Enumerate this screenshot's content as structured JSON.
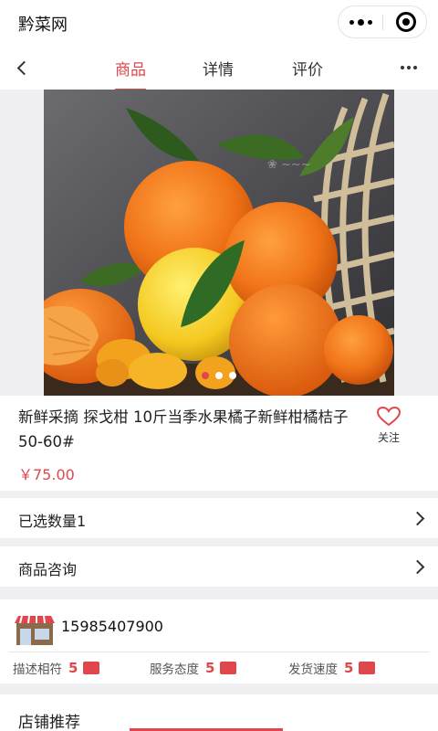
{
  "app": {
    "title": "黔菜网"
  },
  "capsule": {
    "more_icon": "more-dots-icon",
    "close_icon": "close-circle-icon"
  },
  "tabs": [
    {
      "label": "商品",
      "active": true
    },
    {
      "label": "详情",
      "active": false
    },
    {
      "label": "评价",
      "active": false
    }
  ],
  "gallery": {
    "slide_count": 3,
    "active_index": 0
  },
  "product": {
    "title": "新鲜采摘 探戈柑 10斤当季水果橘子新鲜柑橘桔子 50-60#",
    "price": "￥75.00",
    "favorite_label": "关注"
  },
  "rows": {
    "selected_qty": "已选数量1",
    "consult": "商品咨询"
  },
  "shop": {
    "phone": "15985407900",
    "scores": [
      {
        "label": "描述相符",
        "value": "5"
      },
      {
        "label": "服务态度",
        "value": "5"
      },
      {
        "label": "发货速度",
        "value": "5"
      }
    ]
  },
  "recommend": {
    "title": "店铺推荐"
  },
  "colors": {
    "accent": "#e0474c",
    "background": "#f0f0f2"
  }
}
